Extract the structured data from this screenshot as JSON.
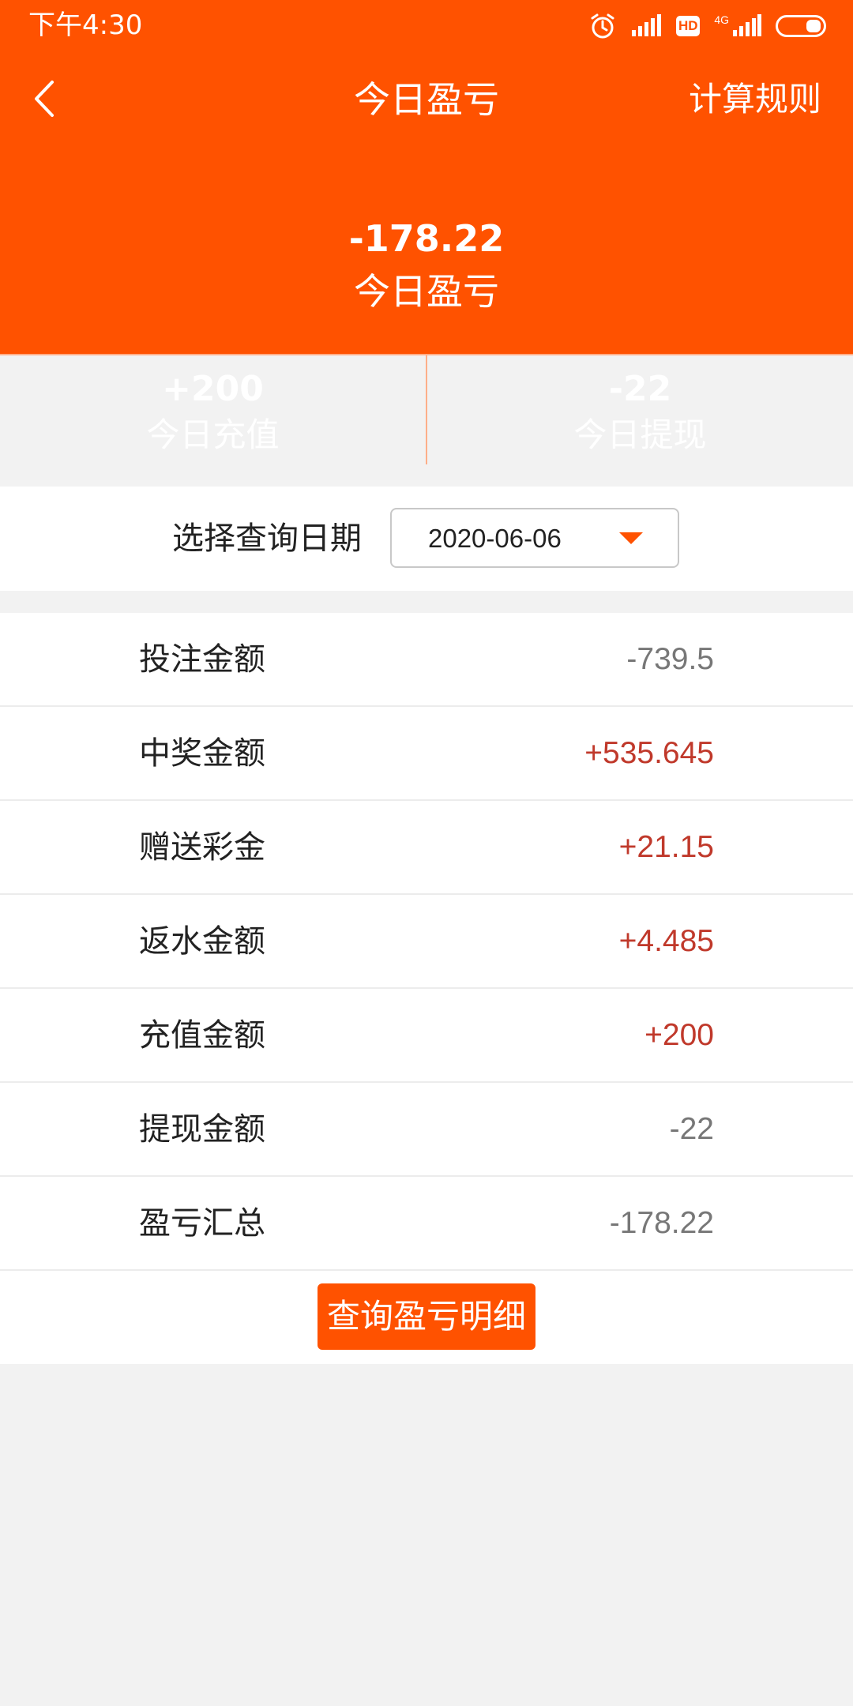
{
  "status_bar": {
    "time": "下午4:30",
    "icons": [
      "alarm-icon",
      "signal-icon",
      "hd-badge",
      "network-4g-icon",
      "battery-icon"
    ],
    "hd_label": "HD",
    "network_label": "4G"
  },
  "header": {
    "title": "今日盈亏",
    "rules_label": "计算规则",
    "summary_value": "-178.22",
    "summary_label": "今日盈亏",
    "recharge_value": "+200",
    "recharge_label": "今日充值",
    "withdraw_value": "-22",
    "withdraw_label": "今日提现"
  },
  "date_filter": {
    "label": "选择查询日期",
    "selected_value": "2020-06-06"
  },
  "stats": [
    {
      "label": "投注金额",
      "value": "-739.5",
      "tone": "neutral"
    },
    {
      "label": "中奖金额",
      "value": "+535.645",
      "tone": "positive"
    },
    {
      "label": "赠送彩金",
      "value": "+21.15",
      "tone": "positive"
    },
    {
      "label": "返水金额",
      "value": "+4.485",
      "tone": "positive"
    },
    {
      "label": "充值金额",
      "value": "+200",
      "tone": "positive"
    },
    {
      "label": "提现金额",
      "value": "-22",
      "tone": "neutral"
    },
    {
      "label": "盈亏汇总",
      "value": "-178.22",
      "tone": "neutral"
    }
  ],
  "actions": {
    "detail_button_label": "查询盈亏明细"
  },
  "colors": {
    "primary": "#ff5200",
    "positive_text": "#c0392b",
    "neutral_text": "#777777",
    "background": "#f2f2f2"
  }
}
